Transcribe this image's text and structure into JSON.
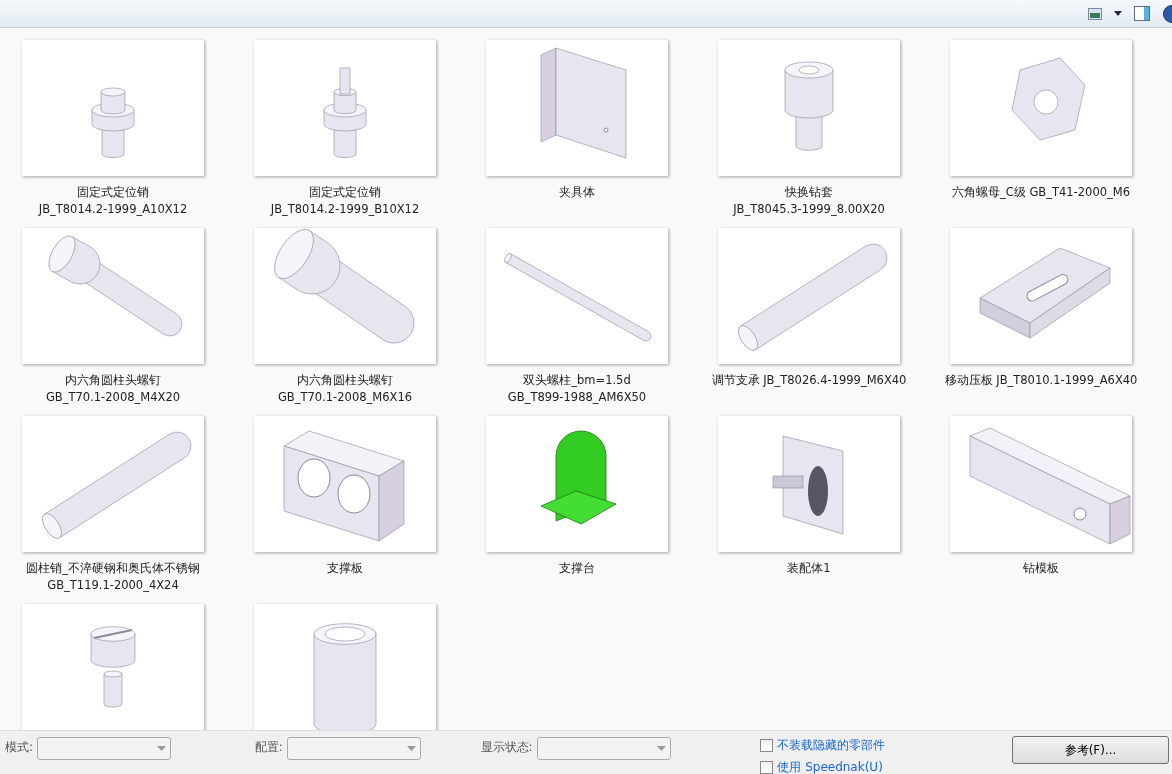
{
  "items": [
    {
      "kind": "pin",
      "label_lines": [
        "固定式定位销",
        "JB_T8014.2-1999_A10X12"
      ]
    },
    {
      "kind": "diamond-pin",
      "label_lines": [
        "固定式定位销",
        "JB_T8014.2-1999_B10X12"
      ]
    },
    {
      "kind": "bracket",
      "label_lines": [
        "夹具体"
      ]
    },
    {
      "kind": "bushing",
      "label_lines": [
        "快换钻套",
        "JB_T8045.3-1999_8.00X20"
      ]
    },
    {
      "kind": "nut",
      "label_lines": [
        "六角螺母_C级 GB_T41-2000_M6"
      ]
    },
    {
      "kind": "screw",
      "label_lines": [
        "内六角圆柱头螺钉",
        "GB_T70.1-2008_M4X20"
      ]
    },
    {
      "kind": "screw-short",
      "label_lines": [
        "内六角圆柱头螺钉",
        "GB_T70.1-2008_M6X16"
      ]
    },
    {
      "kind": "stud",
      "label_lines": [
        "双头螺柱_bm=1.5d",
        "GB_T899-1988_AM6X50"
      ]
    },
    {
      "kind": "rod",
      "label_lines": [
        "调节支承 JB_T8026.4-1999_M6X40"
      ]
    },
    {
      "kind": "plate",
      "label_lines": [
        "移动压板 JB_T8010.1-1999_A6X40"
      ]
    },
    {
      "kind": "rod",
      "label_lines": [
        "圆柱销_不淬硬钢和奥氏体不锈钢",
        "GB_T119.1-2000_4X24"
      ]
    },
    {
      "kind": "block",
      "label_lines": [
        "支撑板"
      ]
    },
    {
      "kind": "stand",
      "label_lines": [
        "支撑台"
      ]
    },
    {
      "kind": "assembly",
      "label_lines": [
        "装配体1"
      ]
    },
    {
      "kind": "bar",
      "label_lines": [
        "钻模板"
      ]
    },
    {
      "kind": "slotted-pin"
    },
    {
      "kind": "sleeve"
    }
  ],
  "fields": [
    {
      "label": "模式:"
    },
    {
      "label": "配置:"
    },
    {
      "label": "显示状态:"
    }
  ],
  "checkboxes": [
    {
      "label": "不装载隐藏的零部件",
      "checked": false
    },
    {
      "label": "使用 Speednak(U)",
      "checked": false
    }
  ],
  "browse_button": "参考(F)..."
}
